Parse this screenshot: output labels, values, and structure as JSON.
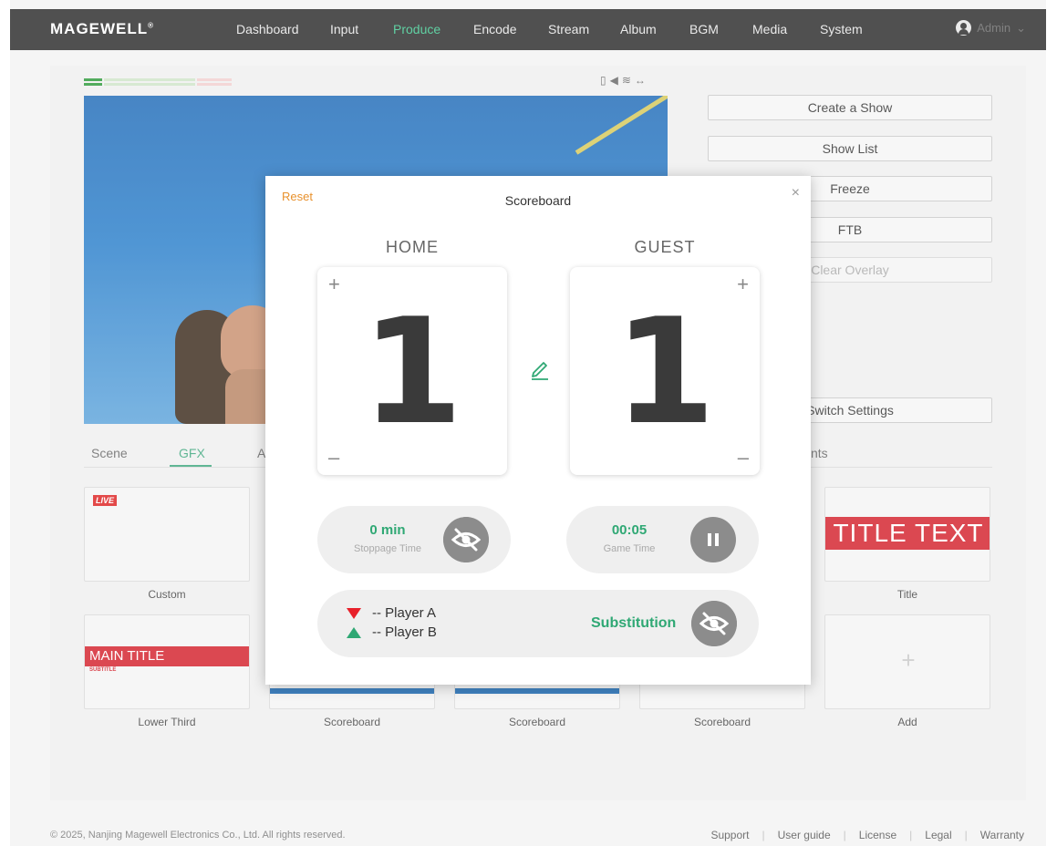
{
  "app": {
    "logo": "MAGEWELL",
    "nav": [
      "Dashboard",
      "Input",
      "Produce",
      "Encode",
      "Stream",
      "Album",
      "BGM",
      "Media",
      "System"
    ],
    "active_nav": "Produce",
    "user": "Admin"
  },
  "produce": {
    "side_buttons": {
      "create_show": "Create a Show",
      "show_list": "Show List",
      "freeze": "Freeze",
      "ftb": "FTB",
      "clear_overlay": "Clear Overlay",
      "switch_settings": "Switch Settings"
    },
    "tabs": {
      "scene": "Scene",
      "gfx": "GFX",
      "audio_partial": "A",
      "right_partial": "nts"
    },
    "cards": [
      {
        "label": "Custom",
        "badge": "LIVE"
      },
      {
        "label": "Title",
        "preview_text": "TITLE TEXT"
      },
      {
        "label": "Lower Third",
        "preview_text": "MAIN TITLE",
        "preview_sub": "SUBTITLE"
      },
      {
        "label": "Scoreboard"
      },
      {
        "label": "Scoreboard"
      },
      {
        "label": "Scoreboard"
      },
      {
        "label": "Add",
        "preview_text": "+"
      }
    ]
  },
  "scoreboard_modal": {
    "reset": "Reset",
    "title": "Scoreboard",
    "close": "×",
    "home": {
      "name": "HOME",
      "score": "1"
    },
    "guest": {
      "name": "GUEST",
      "score": "1"
    },
    "plus": "+",
    "minus": "–",
    "stoppage": {
      "value": "0 min",
      "label": "Stoppage Time"
    },
    "game": {
      "value": "00:05",
      "label": "Game Time"
    },
    "players": {
      "a": "-- Player A",
      "b": "-- Player B"
    },
    "substitution": "Substitution"
  },
  "footer": {
    "copyright": "© 2025, Nanjing Magewell Electronics Co., Ltd. All rights reserved.",
    "links": [
      "Support",
      "User guide",
      "License",
      "Legal",
      "Warranty"
    ]
  },
  "colors": {
    "accent_green": "#2fa874",
    "reset_orange": "#e8912d",
    "title_red": "#d3202b",
    "topbar": "#2a2a2a"
  }
}
